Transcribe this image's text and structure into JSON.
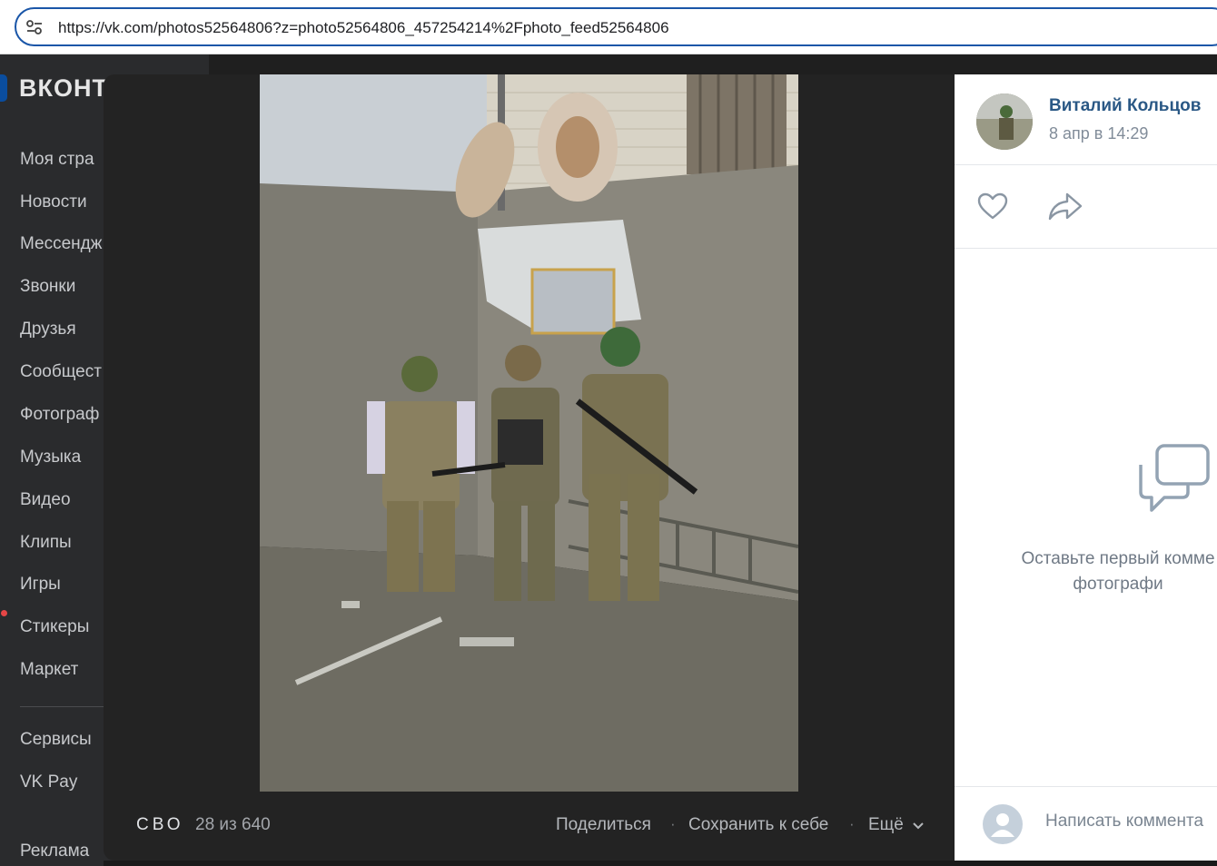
{
  "browser": {
    "url": "https://vk.com/photos52564806?z=photo52564806_457254214%2Fphoto_feed52564806"
  },
  "sidebar": {
    "logo": "ВКОНТ",
    "items": [
      {
        "label": "Моя стра"
      },
      {
        "label": "Новости"
      },
      {
        "label": "Мессендж"
      },
      {
        "label": "Звонки"
      },
      {
        "label": "Друзья"
      },
      {
        "label": "Сообщест"
      },
      {
        "label": "Фотограф"
      },
      {
        "label": "Музыка"
      },
      {
        "label": "Видео"
      },
      {
        "label": "Клипы"
      },
      {
        "label": "Игры"
      },
      {
        "label": "Стикеры"
      },
      {
        "label": "Маркет"
      },
      {
        "label": "Сервисы"
      },
      {
        "label": "VK Pay"
      },
      {
        "label": "Реклама"
      }
    ]
  },
  "viewer": {
    "album": "СВО",
    "counter": "28 из 640",
    "actions": {
      "share": "Поделиться",
      "save": "Сохранить к себе",
      "more": "Ещё"
    }
  },
  "panel": {
    "author": "Виталий Кольцов",
    "date": "8 апр в 14:29",
    "empty_line1": "Оставьте первый комме",
    "empty_line2": "фотографи",
    "comment_placeholder": "Написать коммента"
  },
  "colors": {
    "vk_blue": "#2a5885",
    "url_border": "#1a56a8"
  },
  "icons": [
    "settings-sliders-icon",
    "heart-icon",
    "share-arrow-icon",
    "comments-bubble-icon",
    "user-placeholder-icon",
    "chevron-down-icon"
  ]
}
